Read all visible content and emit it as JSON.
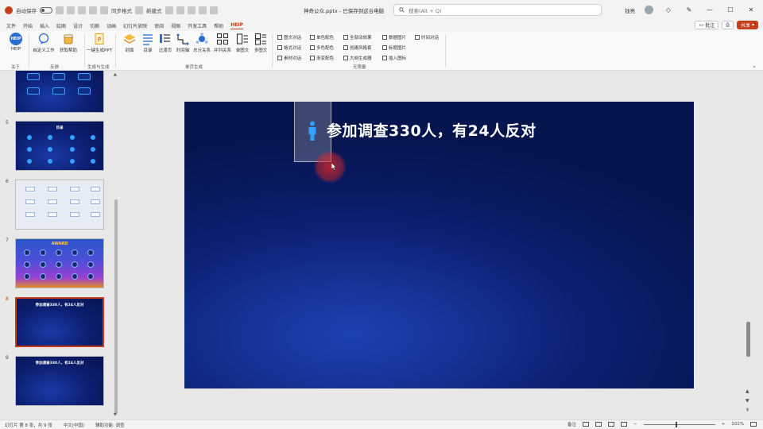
{
  "titlebar": {
    "autosave": "自动保存",
    "doc_title": "神奇公众.pptx - 已保存到这台电脑",
    "search_placeholder": "搜索(Alt + Q)",
    "user": "钱亮",
    "quick_access_labels": [
      "同步格式",
      "新建式"
    ]
  },
  "tabs": [
    "文件",
    "开始",
    "插入",
    "绘图",
    "设计",
    "切换",
    "动画",
    "幻灯片放映",
    "审阅",
    "视图",
    "开发工具",
    "帮助",
    "HEIP"
  ],
  "active_tab": "HEIP",
  "tabs_right": {
    "comments": "批注",
    "share": "共享"
  },
  "ribbon": {
    "buttons": [
      {
        "label": "HEIP",
        "icon": "help-logo-icon"
      },
      {
        "label": "自定义工作",
        "icon": "chat-icon"
      },
      {
        "label": "获取帮助",
        "icon": "cup-icon"
      },
      {
        "label": "一键生成PPT",
        "icon": "document-icon"
      },
      {
        "label": "封面",
        "icon": "layers-icon"
      },
      {
        "label": "目录",
        "icon": "list-icon"
      },
      {
        "label": "过渡页",
        "icon": "lines-icon"
      },
      {
        "label": "时间轴",
        "icon": "timeline-icon"
      },
      {
        "label": "总分关系",
        "icon": "hierarchy-icon"
      },
      {
        "label": "并列关系",
        "icon": "grid-icon"
      },
      {
        "label": "单图文",
        "icon": "image-icon"
      },
      {
        "label": "多图文",
        "icon": "images-icon"
      }
    ],
    "groups": [
      "关于",
      "反馈",
      "生成与生成",
      "单页生成",
      "无限量"
    ],
    "checkboxes": [
      [
        "图文对话",
        "单色配色",
        "全部动效果",
        "数据图片",
        "时间对话"
      ],
      [
        "格式对话",
        "多色配色",
        "创建风格套",
        "标题图片"
      ],
      [
        "素材对话",
        "渐变配色",
        "大纲生成器",
        "插入图标"
      ]
    ]
  },
  "thumbnails": [
    {
      "number": "5",
      "title": "目录"
    },
    {
      "number": "6",
      "title": ""
    },
    {
      "number": "7",
      "title": "AWARD"
    },
    {
      "number": "8",
      "title": "参加调查330人，有24人反对"
    },
    {
      "number": "9",
      "title": "参加调查330人，有24人反对"
    }
  ],
  "active_slide": "8",
  "slide": {
    "title": "参加调查330人，有24人反对",
    "background": "#0b1e6e",
    "accent": "#2fa3ff"
  },
  "status": {
    "slide_info": "幻灯片 第 8 张，共 9 张",
    "language": "中文(中国)",
    "accessibility": "辅助功能: 调查",
    "notes": "备注",
    "zoom": "101%"
  }
}
